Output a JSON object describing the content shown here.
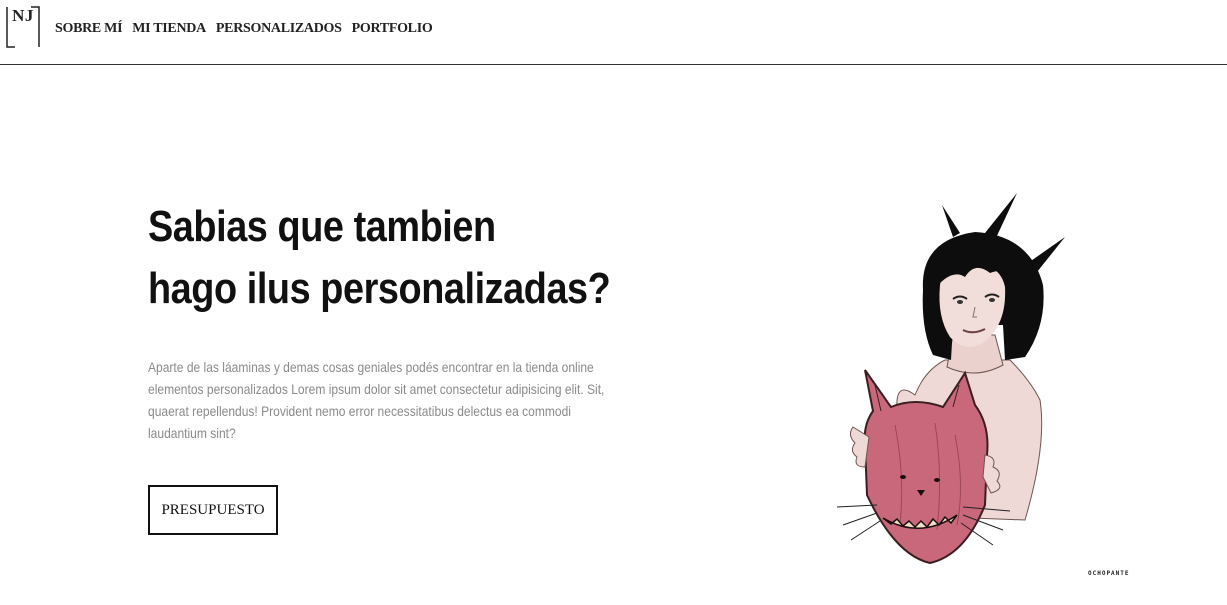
{
  "header": {
    "logo_text": "NJ",
    "nav": [
      {
        "label": "SOBRE MÍ"
      },
      {
        "label": "MI TIENDA"
      },
      {
        "label": "PERSONALIZADOS"
      },
      {
        "label": "PORTFOLIO"
      }
    ]
  },
  "hero": {
    "title_line1": "Sabias que tambien",
    "title_line2": "hago ilus personalizadas?",
    "description": "Aparte de las láaminas y demas cosas geniales podés encontrar en la tienda online elementos personalizados Lorem ipsum dolor sit amet consectetur adipisicing elit. Sit, quaerat repellendus! Provident nemo error necessitatibus delectus ea commodi laudantium sint?",
    "button_label": "PRESUPUESTO"
  },
  "illustration": {
    "signature": "OCHOPANTE"
  },
  "colors": {
    "text": "#111111",
    "muted": "#8a8a8a",
    "mask": "#c9687a",
    "hair": "#0d0d0d",
    "skin": "#efd9d6"
  }
}
